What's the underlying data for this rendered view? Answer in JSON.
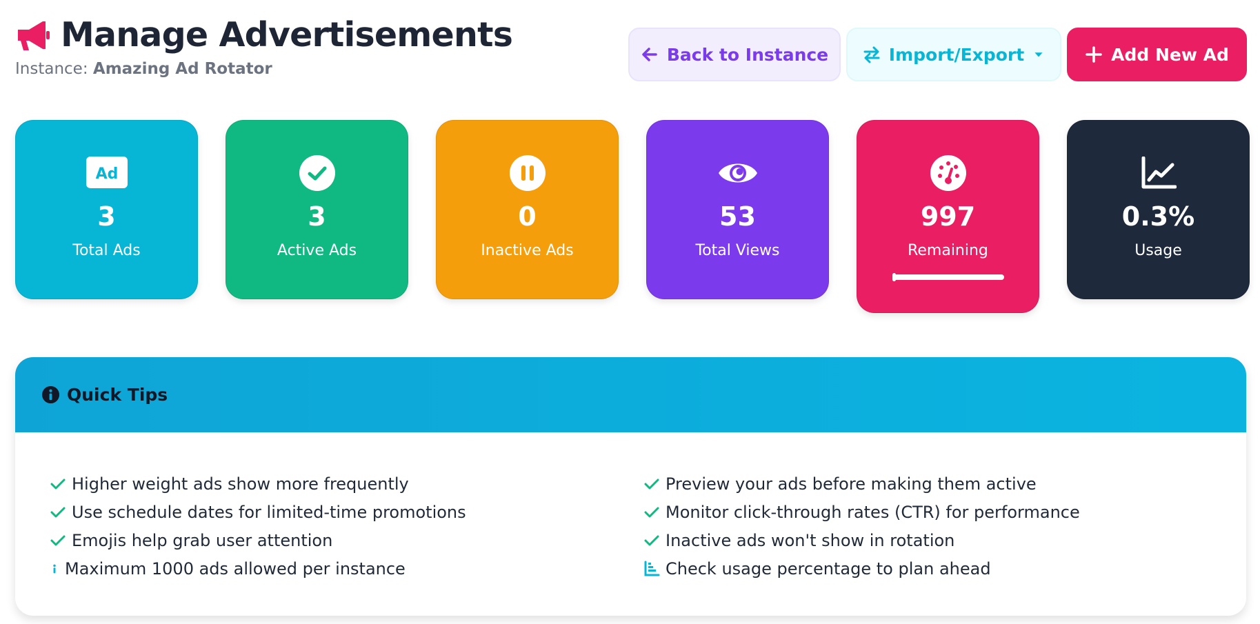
{
  "header": {
    "title": "Manage Advertisements",
    "instance_label": "Instance:",
    "instance_name": "Amazing Ad Rotator",
    "icon": "megaphone-icon",
    "icon_color": "#e91e63"
  },
  "actions": {
    "back_label": "Back to Instance",
    "import_export_label": "Import/Export",
    "add_label": "Add New Ad"
  },
  "stats": [
    {
      "value": "3",
      "label": "Total Ads",
      "icon": "ad-icon",
      "color": "#06b6d4"
    },
    {
      "value": "3",
      "label": "Active Ads",
      "icon": "check-circle-icon",
      "color": "#10b981"
    },
    {
      "value": "0",
      "label": "Inactive Ads",
      "icon": "pause-circle-icon",
      "color": "#f59e0b"
    },
    {
      "value": "53",
      "label": "Total Views",
      "icon": "eye-icon",
      "color": "#7c3aed"
    },
    {
      "value": "997",
      "label": "Remaining",
      "icon": "gauge-icon",
      "color": "#e91e63",
      "usage_fraction": 0.003
    },
    {
      "value": "0.3%",
      "label": "Usage",
      "icon": "chart-line-icon",
      "color": "#1e293b"
    }
  ],
  "tips": {
    "title": "Quick Tips",
    "left": [
      {
        "text": "Higher weight ads show more frequently",
        "icon": "check-icon"
      },
      {
        "text": "Use schedule dates for limited-time promotions",
        "icon": "check-icon"
      },
      {
        "text": "Emojis help grab user attention",
        "icon": "check-icon"
      },
      {
        "text": "Maximum 1000 ads allowed per instance",
        "icon": "info-icon"
      }
    ],
    "right": [
      {
        "text": "Preview your ads before making them active",
        "icon": "check-icon"
      },
      {
        "text": "Monitor click-through rates (CTR) for performance",
        "icon": "check-icon"
      },
      {
        "text": "Inactive ads won't show in rotation",
        "icon": "check-icon"
      },
      {
        "text": "Check usage percentage to plan ahead",
        "icon": "chart-bar-icon"
      }
    ]
  }
}
